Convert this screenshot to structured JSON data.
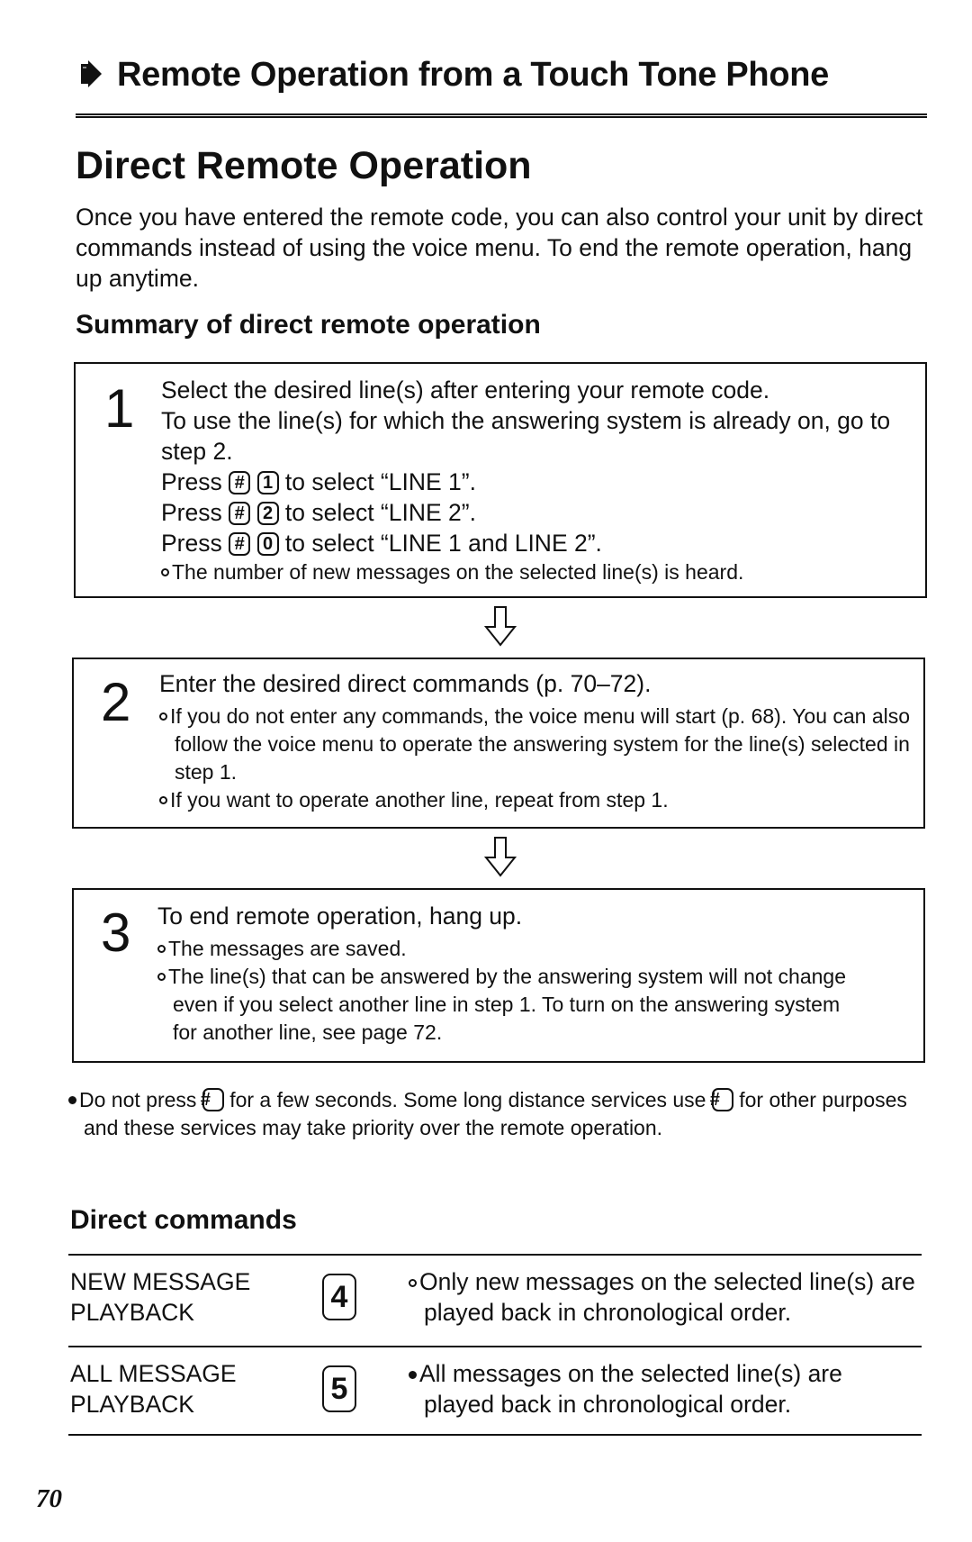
{
  "header": {
    "section_title": "Remote Operation from a Touch Tone Phone",
    "icon": "arrow-right-icon"
  },
  "page_title": "Direct Remote Operation",
  "intro": "Once you have entered the remote code, you can also control your unit by direct commands instead of using the voice menu. To end the remote operation, hang up anytime.",
  "summary": {
    "heading": "Summary of direct remote operation",
    "steps": [
      {
        "number": "1",
        "lines": [
          "Select the desired line(s) after entering your remote code.",
          "To use the line(s) for which the answering system is already on, go to step 2."
        ],
        "press_prefix": "Press",
        "press_rows": [
          {
            "keys": [
              "#",
              "1"
            ],
            "text": "to select “LINE 1”."
          },
          {
            "keys": [
              "#",
              "2"
            ],
            "text": "to select “LINE 2”."
          },
          {
            "keys": [
              "#",
              "0"
            ],
            "text": "to select “LINE 1 and LINE 2”."
          }
        ],
        "notes": [
          "The number of new messages on the selected line(s) is heard."
        ]
      },
      {
        "number": "2",
        "lines": [
          "Enter the desired direct commands (p. 70–72)."
        ],
        "notes": [
          "If you do not enter any commands, the voice menu will start (p. 68). You can also follow the voice menu to operate the answering system for the line(s) selected in step 1.",
          "If you want to operate another line, repeat from step 1."
        ]
      },
      {
        "number": "3",
        "lines": [
          "To end remote operation, hang up."
        ],
        "notes": [
          "The messages are saved.",
          "The line(s) that can be answered by the answering system will not change even if you select another line in step 1. To turn on the answering system for another line, see page 72."
        ]
      }
    ],
    "arrow_icon": "down-arrow-icon"
  },
  "caution": {
    "part1": "Do not press",
    "key": "#",
    "part2": "for a few seconds. Some long distance services use",
    "part3": "for other purposes and these services may take priority over the remote operation."
  },
  "direct_commands": {
    "heading": "Direct commands",
    "rows": [
      {
        "label_line1": "NEW MESSAGE",
        "label_line2": "PLAYBACK",
        "key": "4",
        "description": "Only new messages on the selected line(s) are played back in chronological order."
      },
      {
        "label_line1": "ALL MESSAGE",
        "label_line2": "PLAYBACK",
        "key": "5",
        "description": "All messages on the selected line(s) are played back in chronological order."
      }
    ]
  },
  "page_number": "70"
}
